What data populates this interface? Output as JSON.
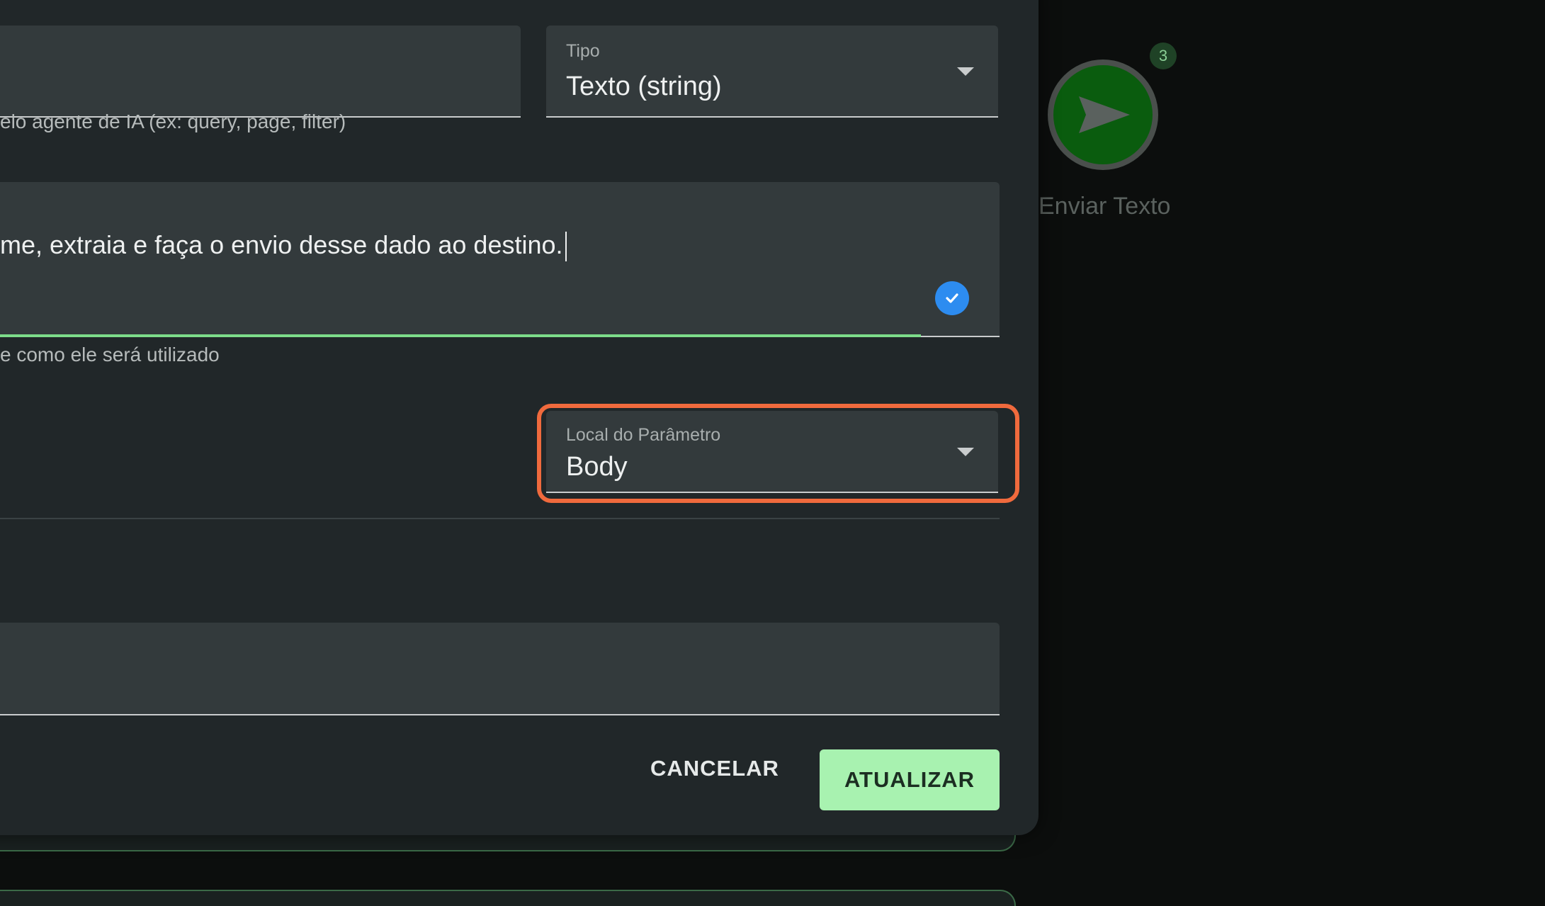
{
  "dialog": {
    "type_field": {
      "label": "Tipo",
      "value": "Texto (string)"
    },
    "name_helper": "elo agente de IA (ex: query, page, filter)",
    "description_field": {
      "value": "me, extraia e faça o envio desse dado ao destino."
    },
    "description_helper": "e como ele será utilizado",
    "location_field": {
      "label": "Local do Parâmetro",
      "value": "Body"
    },
    "actions": {
      "cancel_label": "CANCELAR",
      "update_label": "ATUALIZAR"
    }
  },
  "flow_node": {
    "badge": "3",
    "label": "Enviar Texto",
    "icon": "send-icon"
  },
  "colors": {
    "accent_green": "#a8f2b0",
    "highlight": "#f06a3d",
    "check_blue": "#2d8cf0"
  }
}
